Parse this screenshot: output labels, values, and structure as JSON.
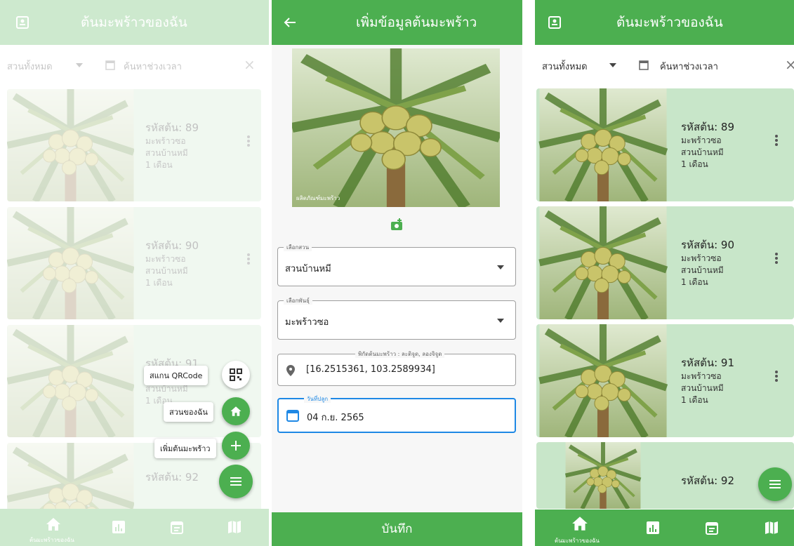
{
  "colors": {
    "primary": "#4caf50",
    "card_bg": "#c8e6c9",
    "focus": "#1e88e5"
  },
  "list_screen": {
    "title": "ต้นมะพร้าวของฉัน",
    "filter": {
      "garden_value": "สวนทั้งหมด",
      "date_search_placeholder": "ค้นหาช่วงเวลา"
    },
    "trees": [
      {
        "code": "รหัสต้น: 89",
        "variety": "มะพร้าวซอ",
        "garden": "สวนบ้านหมี",
        "age": "1 เดือน"
      },
      {
        "code": "รหัสต้น: 90",
        "variety": "มะพร้าวซอ",
        "garden": "สวนบ้านหมี",
        "age": "1 เดือน"
      },
      {
        "code": "รหัสต้น: 91",
        "variety": "มะพร้าวซอ",
        "garden": "สวนบ้านหมี",
        "age": "1 เดือน"
      },
      {
        "code": "รหัสต้น: 92",
        "variety": "",
        "garden": "",
        "age": ""
      }
    ],
    "bottom_nav": {
      "home_label": "ต้นมะพร้าวของฉัน",
      "icons": [
        "home-icon",
        "chart-icon",
        "calendar-icon",
        "map-icon"
      ]
    },
    "speed_dial": {
      "scan_qr_label": "สแกน QRCode",
      "my_garden_label": "สวนของฉัน",
      "add_tree_label": "เพิ่มต้นมะพร้าว"
    }
  },
  "add_screen": {
    "title": "เพิ่มข้อมูลต้นมะพร้าว",
    "photo_caption": "ผลิตภัณฑ์มะพร้าว",
    "fields": {
      "garden": {
        "label": "เลือกสวน",
        "value": "สวนบ้านหมี"
      },
      "variety": {
        "label": "เลือกพันธุ์",
        "value": "มะพร้าวซอ"
      },
      "location": {
        "label": "พิกัดต้นมะพร้าว : ละติจูด, ลองจิจูด",
        "value": "[16.2515361, 103.2589934]"
      },
      "planted_date": {
        "label": "วันที่ปลูก",
        "value": "04 ก.ย. 2565"
      }
    },
    "save_label": "บันทึก"
  }
}
